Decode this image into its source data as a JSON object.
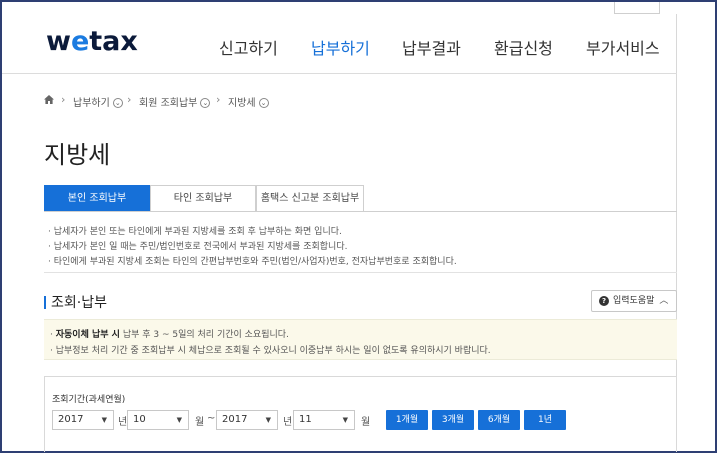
{
  "logo": {
    "pre": "w",
    "o": "e",
    "post": "tax"
  },
  "gnb": [
    "신고하기",
    "납부하기",
    "납부결과",
    "환급신청",
    "부가서비스"
  ],
  "breadcrumb": {
    "home": "home-icon",
    "items": [
      "납부하기",
      "회원 조회납부",
      "지방세"
    ]
  },
  "page_title": "지방세",
  "tabs": [
    "본인 조회납부",
    "타인 조회납부",
    "홈택스 신고분 조회납부"
  ],
  "notes": [
    "· 납세자가 본인 또는 타인에게 부과된 지방세를 조회 후 납부하는 화면 입니다.",
    "· 납세자가 본인 일 때는 주민/법인번호로 전국에서 부과된 지방세를 조회합니다.",
    "· 타인에게 부과된 지방세 조회는 타인의 간편납부번호와 주민(법인/사업자)번호, 전자납부번호로 조회합니다."
  ],
  "section_title": "조회·납부",
  "help_button": "입력도움말",
  "info": {
    "bullet": "· ",
    "bold": "자동이체 납부 시",
    "line1_rest": " 납부 후 3 ~ 5일의 처리 기간이 소요됩니다.",
    "line2": "· 납부정보 처리 기간 중 조회납부 시 체납으로 조회될 수 있사오니 이중납부 하시는 일이 없도록 유의하시기 바랍니다."
  },
  "form": {
    "label": "조회기간(과세연월)",
    "from_year": "2017",
    "year_unit": "년",
    "from_month": "10",
    "month_unit": "월",
    "tilde": "~",
    "to_year": "2017",
    "to_month": "11",
    "periods": [
      "1개월",
      "3개월",
      "6개월",
      "1년"
    ]
  },
  "colors": {
    "accent": "#1670d8",
    "frame": "#2e3f73",
    "info_bg": "#fbf9ea"
  }
}
